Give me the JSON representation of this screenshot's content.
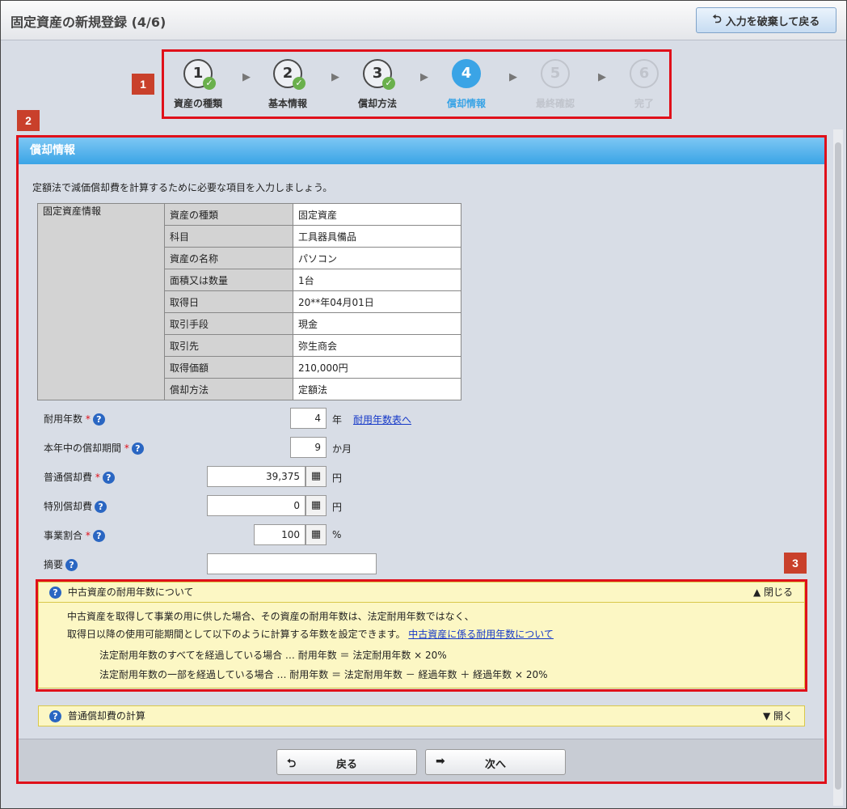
{
  "window": {
    "title": "固定資産の新規登録 (4/6)"
  },
  "toolbar": {
    "discard_label": "入力を破棄して戻る"
  },
  "markers": [
    "1",
    "2",
    "3"
  ],
  "steps": [
    {
      "num": "1",
      "label": "資産の種類",
      "state": "done"
    },
    {
      "num": "2",
      "label": "基本情報",
      "state": "done"
    },
    {
      "num": "3",
      "label": "償却方法",
      "state": "done"
    },
    {
      "num": "4",
      "label": "償却情報",
      "state": "active"
    },
    {
      "num": "5",
      "label": "最終確認",
      "state": "todo"
    },
    {
      "num": "6",
      "label": "完了",
      "state": "todo"
    }
  ],
  "panel": {
    "title": "償却情報",
    "intro": "定額法で減価償却費を計算するために必要な項目を入力しましょう。"
  },
  "asset_table": {
    "group_label": "固定資産情報",
    "rows": [
      {
        "label": "資産の種類",
        "value": "固定資産"
      },
      {
        "label": "科目",
        "value": "工具器具備品"
      },
      {
        "label": "資産の名称",
        "value": "パソコン"
      },
      {
        "label": "面積又は数量",
        "value": "1台"
      },
      {
        "label": "取得日",
        "value": "20**年04月01日"
      },
      {
        "label": "取引手段",
        "value": "現金"
      },
      {
        "label": "取引先",
        "value": "弥生商会"
      },
      {
        "label": "取得価額",
        "value": "210,000円"
      },
      {
        "label": "償却方法",
        "value": "定額法"
      }
    ]
  },
  "form": {
    "useful_life": {
      "label": "耐用年数",
      "value": "4",
      "unit": "年",
      "link": "耐用年数表へ"
    },
    "period": {
      "label": "本年中の償却期間",
      "value": "9",
      "unit": "か月"
    },
    "normal_dep": {
      "label": "普通償却費",
      "value": "39,375",
      "unit": "円"
    },
    "special_dep": {
      "label": "特別償却費",
      "value": "0",
      "unit": "円"
    },
    "business_ratio": {
      "label": "事業割合",
      "value": "100",
      "unit": "%"
    },
    "memo": {
      "label": "摘要",
      "value": ""
    },
    "required_mark": "*",
    "calc_icon": "calculator-icon",
    "help_icon": "question-icon",
    "help_glyph": "?"
  },
  "accordion_used": {
    "title": "中古資産の耐用年数について",
    "toggle": "▲ 閉じる",
    "line1": "中古資産を取得して事業の用に供した場合、その資産の耐用年数は、法定耐用年数ではなく、",
    "line2": "取得日以降の使用可能期間として以下のように計算する年数を設定できます。",
    "link": "中古資産に係る耐用年数について",
    "formula1": "法定耐用年数のすべてを経過している場合 … 耐用年数 ＝ 法定耐用年数 × 20%",
    "formula2": "法定耐用年数の一部を経過している場合 … 耐用年数 ＝ 法定耐用年数 － 経過年数 ＋ 経過年数 × 20%"
  },
  "accordion_calc": {
    "title": "普通償却費の計算",
    "toggle": "▼ 開く"
  },
  "footer": {
    "back_label": "戻る",
    "next_label": "次へ"
  },
  "colors": {
    "accent": "#3aa4e6",
    "marker": "#c9402b",
    "highlight": "#e0101a",
    "note_bg": "#fcf7c4"
  }
}
